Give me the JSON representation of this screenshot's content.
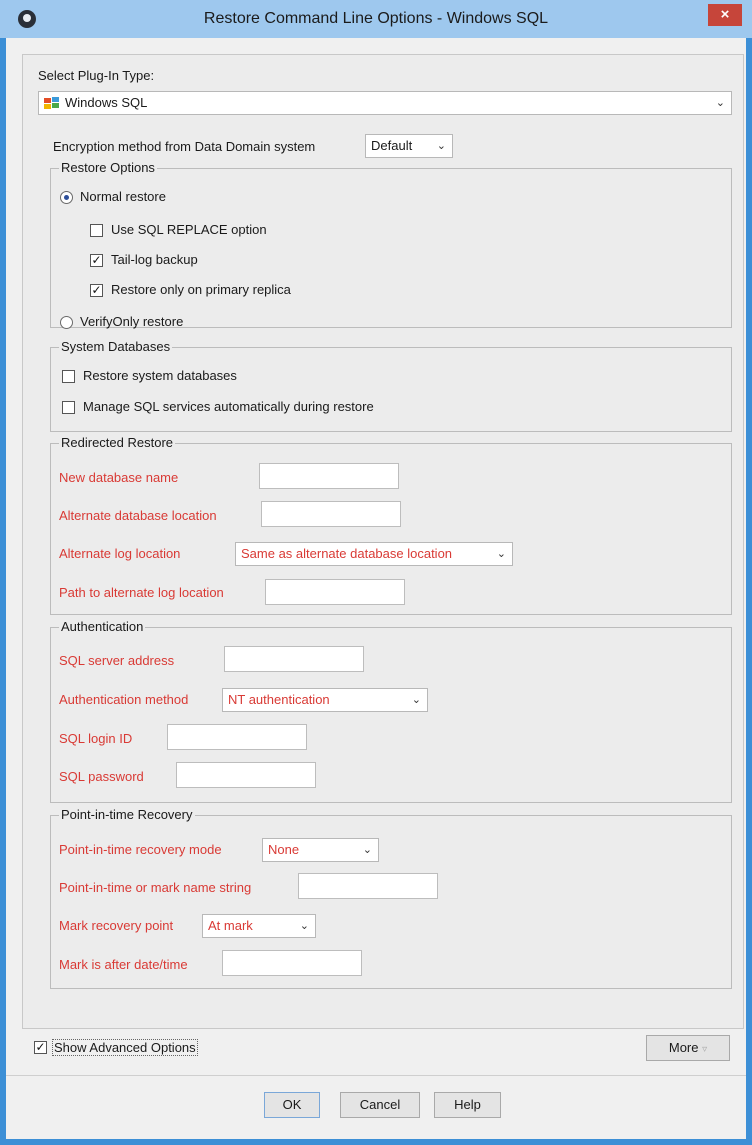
{
  "window": {
    "title": "Restore Command Line Options - Windows SQL",
    "close_glyph": "×"
  },
  "plugin": {
    "label": "Select Plug-In Type:",
    "value": "Windows SQL"
  },
  "encryption": {
    "label": "Encryption method from Data Domain system",
    "value": "Default"
  },
  "restore_options": {
    "title": "Restore Options",
    "normal_restore": "Normal restore",
    "use_replace": "Use SQL REPLACE option",
    "tail_log": "Tail-log backup",
    "primary_replica": "Restore only on primary replica",
    "verify_only": "VerifyOnly restore"
  },
  "system_databases": {
    "title": "System Databases",
    "restore_system": "Restore system databases",
    "manage_services": "Manage SQL services automatically during restore"
  },
  "redirected_restore": {
    "title": "Redirected Restore",
    "new_db_name": "New database name",
    "alt_db_location": "Alternate database location",
    "alt_log_location": "Alternate log location",
    "alt_log_location_value": "Same as alternate database location",
    "path_alt_log": "Path to alternate log location"
  },
  "authentication": {
    "title": "Authentication",
    "server_address": "SQL server address",
    "auth_method": "Authentication method",
    "auth_method_value": "NT authentication",
    "login_id": "SQL login ID",
    "password": "SQL password"
  },
  "point_in_time": {
    "title": "Point-in-time Recovery",
    "mode": "Point-in-time recovery mode",
    "mode_value": "None",
    "mark_string": "Point-in-time or mark name string",
    "mark_point": "Mark recovery point",
    "mark_point_value": "At mark",
    "mark_after": "Mark is after date/time"
  },
  "footer": {
    "show_advanced": "Show Advanced Options",
    "more": "More",
    "ok": "OK",
    "cancel": "Cancel",
    "help": "Help"
  },
  "icons": [
    "app-icon",
    "close-icon",
    "sql-server-icon",
    "chevron-down-icon",
    "check-icon"
  ],
  "colors": {
    "required_label": "#d93a35",
    "title_bar": "#9ec8ee",
    "window_border": "#3c8fd6"
  }
}
